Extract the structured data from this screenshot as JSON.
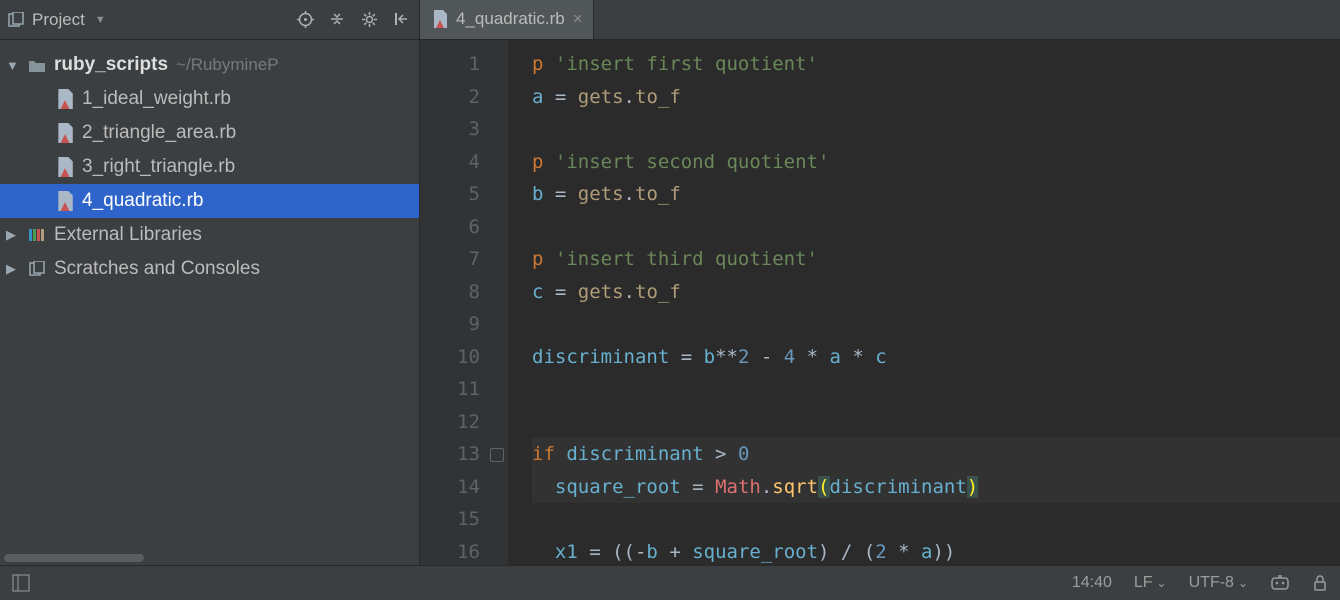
{
  "project_panel": {
    "title": "Project",
    "toolbar_icons": [
      "target-icon",
      "collapse-icon",
      "settings-icon",
      "hide-icon"
    ],
    "tree": {
      "root": {
        "label": "ruby_scripts",
        "hint": "~/RubymineP"
      },
      "files": [
        {
          "label": "1_ideal_weight.rb",
          "selected": false
        },
        {
          "label": "2_triangle_area.rb",
          "selected": false
        },
        {
          "label": "3_right_triangle.rb",
          "selected": false
        },
        {
          "label": "4_quadratic.rb",
          "selected": true
        }
      ],
      "extra": [
        {
          "label": "External Libraries",
          "icon": "libraries-icon"
        },
        {
          "label": "Scratches and Consoles",
          "icon": "scratches-icon"
        }
      ]
    }
  },
  "editor": {
    "tab_label": "4_quadratic.rb",
    "line_count": 16,
    "lines": [
      [
        {
          "t": "p ",
          "c": "tok-kw"
        },
        {
          "t": "'insert first quotient'",
          "c": "tok-str"
        }
      ],
      [
        {
          "t": "a",
          "c": "tok-ident"
        },
        {
          "t": " = ",
          "c": "tok-op"
        },
        {
          "t": "gets",
          "c": "tok-method"
        },
        {
          "t": ".",
          "c": "tok-op"
        },
        {
          "t": "to_f",
          "c": "tok-method"
        }
      ],
      [],
      [
        {
          "t": "p ",
          "c": "tok-kw"
        },
        {
          "t": "'insert second quotient'",
          "c": "tok-str"
        }
      ],
      [
        {
          "t": "b",
          "c": "tok-ident"
        },
        {
          "t": " = ",
          "c": "tok-op"
        },
        {
          "t": "gets",
          "c": "tok-method"
        },
        {
          "t": ".",
          "c": "tok-op"
        },
        {
          "t": "to_f",
          "c": "tok-method"
        }
      ],
      [],
      [
        {
          "t": "p ",
          "c": "tok-kw"
        },
        {
          "t": "'insert third quotient'",
          "c": "tok-str"
        }
      ],
      [
        {
          "t": "c",
          "c": "tok-ident"
        },
        {
          "t": " = ",
          "c": "tok-op"
        },
        {
          "t": "gets",
          "c": "tok-method"
        },
        {
          "t": ".",
          "c": "tok-op"
        },
        {
          "t": "to_f",
          "c": "tok-method"
        }
      ],
      [],
      [
        {
          "t": "discriminant",
          "c": "tok-ident"
        },
        {
          "t": " = ",
          "c": "tok-op"
        },
        {
          "t": "b",
          "c": "tok-ident"
        },
        {
          "t": "**",
          "c": "tok-op"
        },
        {
          "t": "2",
          "c": "tok-num"
        },
        {
          "t": " - ",
          "c": "tok-op"
        },
        {
          "t": "4",
          "c": "tok-num"
        },
        {
          "t": " * ",
          "c": "tok-op"
        },
        {
          "t": "a",
          "c": "tok-ident"
        },
        {
          "t": " * ",
          "c": "tok-op"
        },
        {
          "t": "c",
          "c": "tok-ident"
        }
      ],
      [],
      [],
      [
        {
          "t": "if ",
          "c": "tok-kw"
        },
        {
          "t": "discriminant",
          "c": "tok-ident"
        },
        {
          "t": " > ",
          "c": "tok-op"
        },
        {
          "t": "0",
          "c": "tok-num"
        }
      ],
      [
        {
          "t": "  ",
          "c": "tok-op"
        },
        {
          "t": "square_root",
          "c": "tok-ident"
        },
        {
          "t": " = ",
          "c": "tok-op"
        },
        {
          "t": "Math",
          "c": "tok-const"
        },
        {
          "t": ".",
          "c": "tok-op"
        },
        {
          "t": "sqrt",
          "c": "tok-method2"
        },
        {
          "t": "(",
          "c": "tok-paren-y"
        },
        {
          "t": "discriminant",
          "c": "tok-ident"
        },
        {
          "t": ")",
          "c": "tok-paren-y"
        }
      ],
      [],
      [
        {
          "t": "  ",
          "c": "tok-op"
        },
        {
          "t": "x1",
          "c": "tok-ident"
        },
        {
          "t": " = ((-",
          "c": "tok-op"
        },
        {
          "t": "b",
          "c": "tok-ident"
        },
        {
          "t": " + ",
          "c": "tok-op"
        },
        {
          "t": "square_root",
          "c": "tok-ident"
        },
        {
          "t": ") / (",
          "c": "tok-op"
        },
        {
          "t": "2",
          "c": "tok-num"
        },
        {
          "t": " * ",
          "c": "tok-op"
        },
        {
          "t": "a",
          "c": "tok-ident"
        },
        {
          "t": "))",
          "c": "tok-op"
        }
      ]
    ]
  },
  "status": {
    "cursor": "14:40",
    "line_sep": "LF",
    "encoding": "UTF-8"
  }
}
